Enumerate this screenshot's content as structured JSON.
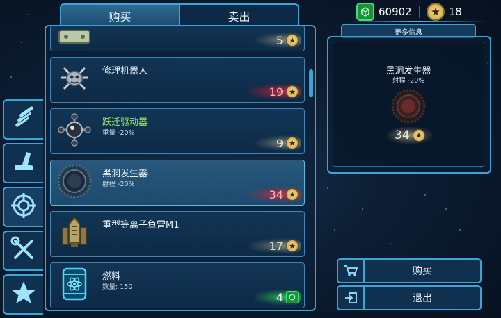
{
  "tabs": {
    "buy": "购买",
    "sell": "卖出",
    "active": "buy"
  },
  "currency": {
    "credits": "60902",
    "stars": "18"
  },
  "categories": [
    {
      "icon": "missiles-icon"
    },
    {
      "icon": "crane-icon"
    },
    {
      "icon": "target-icon"
    },
    {
      "icon": "tools-icon"
    },
    {
      "icon": "star-icon"
    }
  ],
  "items": [
    {
      "name": "",
      "sub": "",
      "price": "5",
      "price_style": "normal",
      "currency": "star",
      "icon": "cash-icon"
    },
    {
      "name": "修理机器人",
      "sub": "",
      "price": "19",
      "price_style": "red",
      "currency": "star",
      "icon": "repair-bot-icon"
    },
    {
      "name": "跃迁驱动器",
      "sub": "重量 -20%",
      "price": "9",
      "price_style": "normal",
      "currency": "star",
      "icon": "warp-drive-icon"
    },
    {
      "name": "黑洞发生器",
      "sub": "射程 -20%",
      "price": "34",
      "price_style": "red",
      "currency": "star",
      "icon": "black-hole-icon",
      "selected": true
    },
    {
      "name": "重型等离子鱼雷M1",
      "sub": "",
      "price": "17",
      "price_style": "normal",
      "currency": "star",
      "icon": "torpedo-icon"
    },
    {
      "name": "燃料",
      "sub": "数量: 150",
      "price": "4",
      "price_style": "green",
      "currency": "cube",
      "icon": "fuel-icon"
    }
  ],
  "info": {
    "header": "更多信息",
    "title": "黑洞发生器",
    "sub": "射程 -20%",
    "price": "34"
  },
  "actions": {
    "buy": "购买",
    "exit": "退出"
  },
  "colors": {
    "accent": "#3aa6d8",
    "green": "#40e07a",
    "red": "#e6283c",
    "gold": "#e6d28c"
  }
}
